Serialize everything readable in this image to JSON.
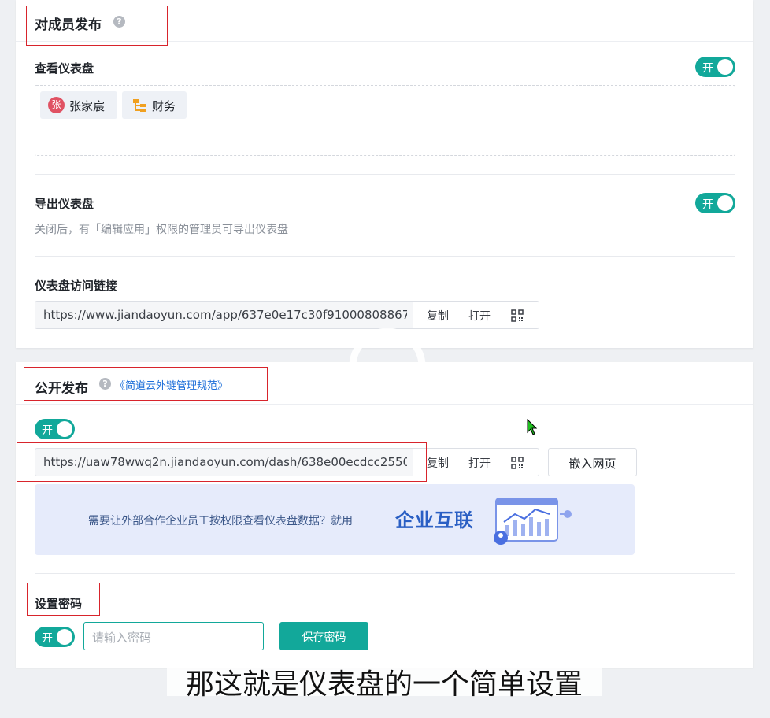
{
  "member_publish": {
    "title": "对成员发布",
    "help_icon": "question-icon",
    "view_dashboard": {
      "label": "查看仪表盘",
      "toggle_label": "开",
      "members": [
        {
          "avatar_text": "张",
          "name": "张家宸",
          "type": "user"
        },
        {
          "icon": "org-chart-icon",
          "name": "财务",
          "type": "department"
        }
      ]
    },
    "export_dashboard": {
      "label": "导出仪表盘",
      "toggle_label": "开",
      "description": "关闭后，有「编辑应用」权限的管理员可导出仪表盘"
    },
    "access_link": {
      "label": "仪表盘访问链接",
      "url": "https://www.jiandaoyun.com/app/637e0e17c30f91000808867f/...",
      "copy_label": "复制",
      "open_label": "打开",
      "qr_icon": "qr-code-icon"
    }
  },
  "public_publish": {
    "title": "公开发布",
    "help_icon": "question-icon",
    "rule_link": "《简道云外链管理规范》",
    "toggle_label": "开",
    "url": "https://uaw78wwq2n.jiandaoyun.com/dash/638e00ecdcc25500...",
    "copy_label": "复制",
    "open_label": "打开",
    "qr_icon": "qr-code-icon",
    "embed_label": "嵌入网页",
    "banner": {
      "text": "需要让外部合作企业员工按权限查看仪表盘数据？就用",
      "brand": "企业互联"
    },
    "password": {
      "label": "设置密码",
      "toggle_label": "开",
      "placeholder": "请输入密码",
      "save_label": "保存密码"
    }
  },
  "subtitle": "那这就是仪表盘的一个简单设置",
  "colors": {
    "accent": "#12a89a",
    "link": "#1e6fd9",
    "highlight_box": "#d8242c",
    "banner_bg": "#e6ebfb"
  }
}
